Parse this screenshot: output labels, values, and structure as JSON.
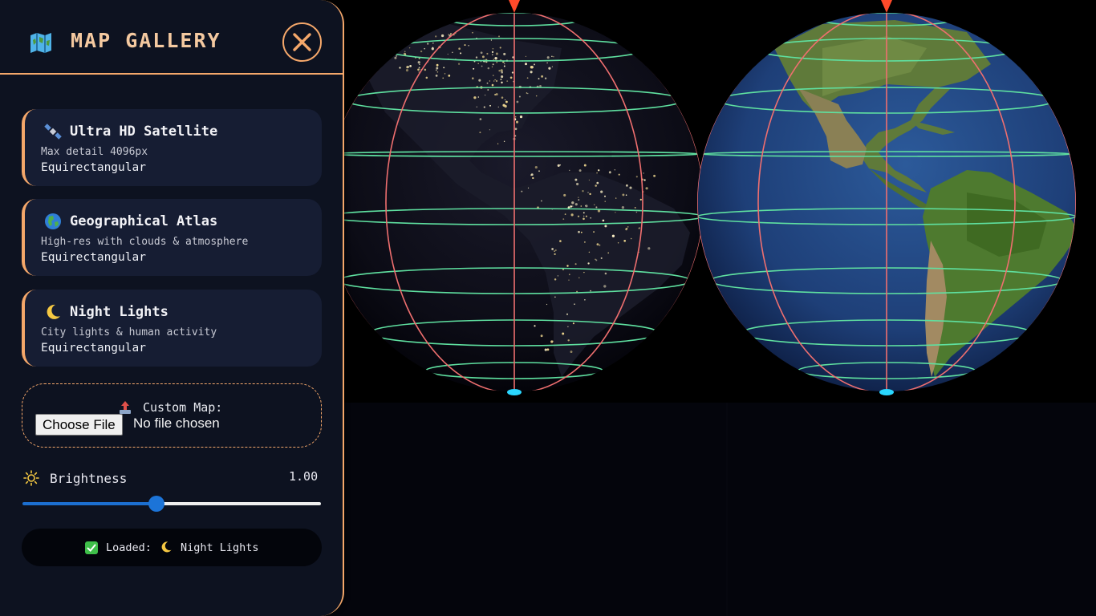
{
  "sidebar": {
    "title": "MAP GALLERY",
    "header_icon": "folded-map-icon",
    "close_icon": "close-icon",
    "maps": [
      {
        "icon": "satellite-icon",
        "title": "Ultra HD Satellite",
        "description": "Max detail 4096px",
        "projection": "Equirectangular"
      },
      {
        "icon": "globe-icon",
        "title": "Geographical Atlas",
        "description": "High-res with clouds & atmosphere",
        "projection": "Equirectangular"
      },
      {
        "icon": "crescent-moon-icon",
        "title": "Night Lights",
        "description": "City lights & human activity",
        "projection": "Equirectangular"
      }
    ],
    "custom": {
      "icon": "upload-icon",
      "label": "Custom Map:",
      "button_label": "Choose File",
      "file_status": "No file chosen"
    },
    "brightness": {
      "icon": "sun-icon",
      "label": "Brightness",
      "value_text": "1.00",
      "slider_fraction": 0.448
    },
    "status": {
      "check_icon": "checkmark-icon",
      "prefix": "Loaded:",
      "moon_icon": "crescent-moon-icon",
      "name": "Night Lights"
    }
  },
  "viewport": {
    "globes": [
      {
        "name": "night-lights-globe",
        "texture": "night-lights"
      },
      {
        "name": "satellite-globe",
        "texture": "satellite"
      }
    ]
  },
  "colors": {
    "accent": "#f4a76a",
    "sidebar_bg": "#0d1220",
    "card_bg": "#161d33",
    "latitude_lines": "#5fe0a0",
    "longitude_lines": "#ef6f6f",
    "pole_marker_north": "#ff4a2a",
    "pole_marker_south": "#2ad7ff",
    "slider_blue": "#1c74d8"
  }
}
